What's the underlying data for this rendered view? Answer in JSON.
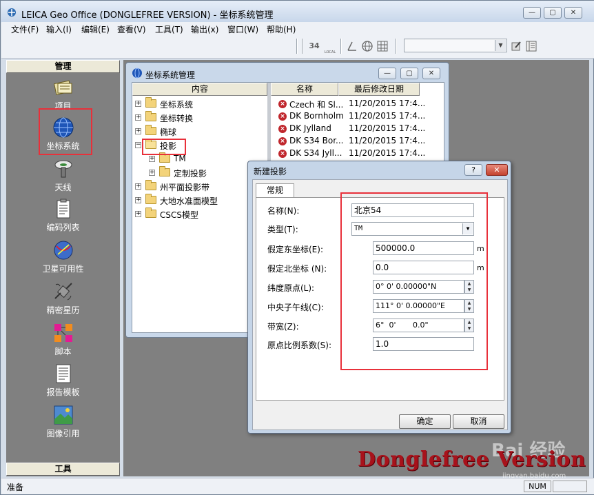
{
  "window": {
    "title": "LEICA Geo Office (DONGLEFREE VERSION) - 坐标系统管理",
    "minimize": "—",
    "maximize": "▢",
    "close": "✕"
  },
  "menu": [
    "文件(F)",
    "输入(I)",
    "编辑(E)",
    "查看(V)",
    "工具(T)",
    "输出(x)",
    "窗口(W)",
    "帮助(H)"
  ],
  "toolbar": {
    "icons": [
      "grid-34-icon",
      "angle-icon",
      "globe-icon",
      "table-grid-icon",
      "edit-icon",
      "panel-icon"
    ],
    "grid_label": "34",
    "grid_sub": "LOCAL",
    "combo_value": ""
  },
  "left_panel": {
    "header": "管理",
    "footer": "工具",
    "items": [
      {
        "label": "项目",
        "icon": "project-icon"
      },
      {
        "label": "坐标系统",
        "icon": "globe-icon"
      },
      {
        "label": "天线",
        "icon": "antenna-icon"
      },
      {
        "label": "编码列表",
        "icon": "codelist-icon"
      },
      {
        "label": "卫星可用性",
        "icon": "satellite-icon"
      },
      {
        "label": "精密星历",
        "icon": "ephemeris-icon"
      },
      {
        "label": "脚本",
        "icon": "script-icon"
      },
      {
        "label": "报告模板",
        "icon": "report-icon"
      },
      {
        "label": "图像引用",
        "icon": "image-ref-icon"
      }
    ]
  },
  "cs_window": {
    "title": "坐标系统管理",
    "tree_header": "内容",
    "col_name": "名称",
    "col_date": "最后修改日期",
    "tree": [
      {
        "label": "坐标系统",
        "expander": "+"
      },
      {
        "label": "坐标转换",
        "expander": "+"
      },
      {
        "label": "椭球",
        "expander": "+"
      },
      {
        "label": "投影",
        "expander": "−"
      },
      {
        "label": "TM",
        "expander": "+"
      },
      {
        "label": "定制投影",
        "expander": "+"
      },
      {
        "label": "州平面投影带",
        "expander": "+"
      },
      {
        "label": "大地水准面模型",
        "expander": "+"
      },
      {
        "label": "CSCS模型",
        "expander": "+"
      }
    ],
    "list": [
      {
        "name": "Czech 和 Sl...",
        "date": "11/20/2015 17:4..."
      },
      {
        "name": "DK Bornholm",
        "date": "11/20/2015 17:4..."
      },
      {
        "name": "DK Jylland",
        "date": "11/20/2015 17:4..."
      },
      {
        "name": "DK S34 Bor...",
        "date": "11/20/2015 17:4..."
      },
      {
        "name": "DK S34 Jyll...",
        "date": "11/20/2015 17:4..."
      }
    ]
  },
  "dialog": {
    "title": "新建投影",
    "help": "?",
    "close": "✕",
    "tab": "常规",
    "fields": {
      "name_label": "名称(N):",
      "name_value": "北京54",
      "type_label": "类型(T):",
      "type_value": "TM",
      "easting_label": "假定东坐标(E):",
      "easting_value": "500000.0",
      "easting_unit": "m",
      "northing_label": "假定北坐标 (N):",
      "northing_value": "0.0",
      "northing_unit": "m",
      "lat_label": "纬度原点(L):",
      "lat_value": "0°  0'  0.00000\"N",
      "cm_label": "中央子午线(C):",
      "cm_value": "111°  0'  0.00000\"E",
      "zone_label": "带宽(Z):",
      "zone_value": "6°  0'       0.0\"",
      "scale_label": "原点比例系数(S):",
      "scale_value": "1.0"
    },
    "ok": "确定",
    "cancel": "取消"
  },
  "status": {
    "text": "准备",
    "num": "NUM"
  },
  "watermark": "Donglefree Version",
  "baidu": "Bai 经验",
  "baidu_url": "jingyan.baidu.com",
  "colors": {
    "highlight": "#e8303a"
  }
}
